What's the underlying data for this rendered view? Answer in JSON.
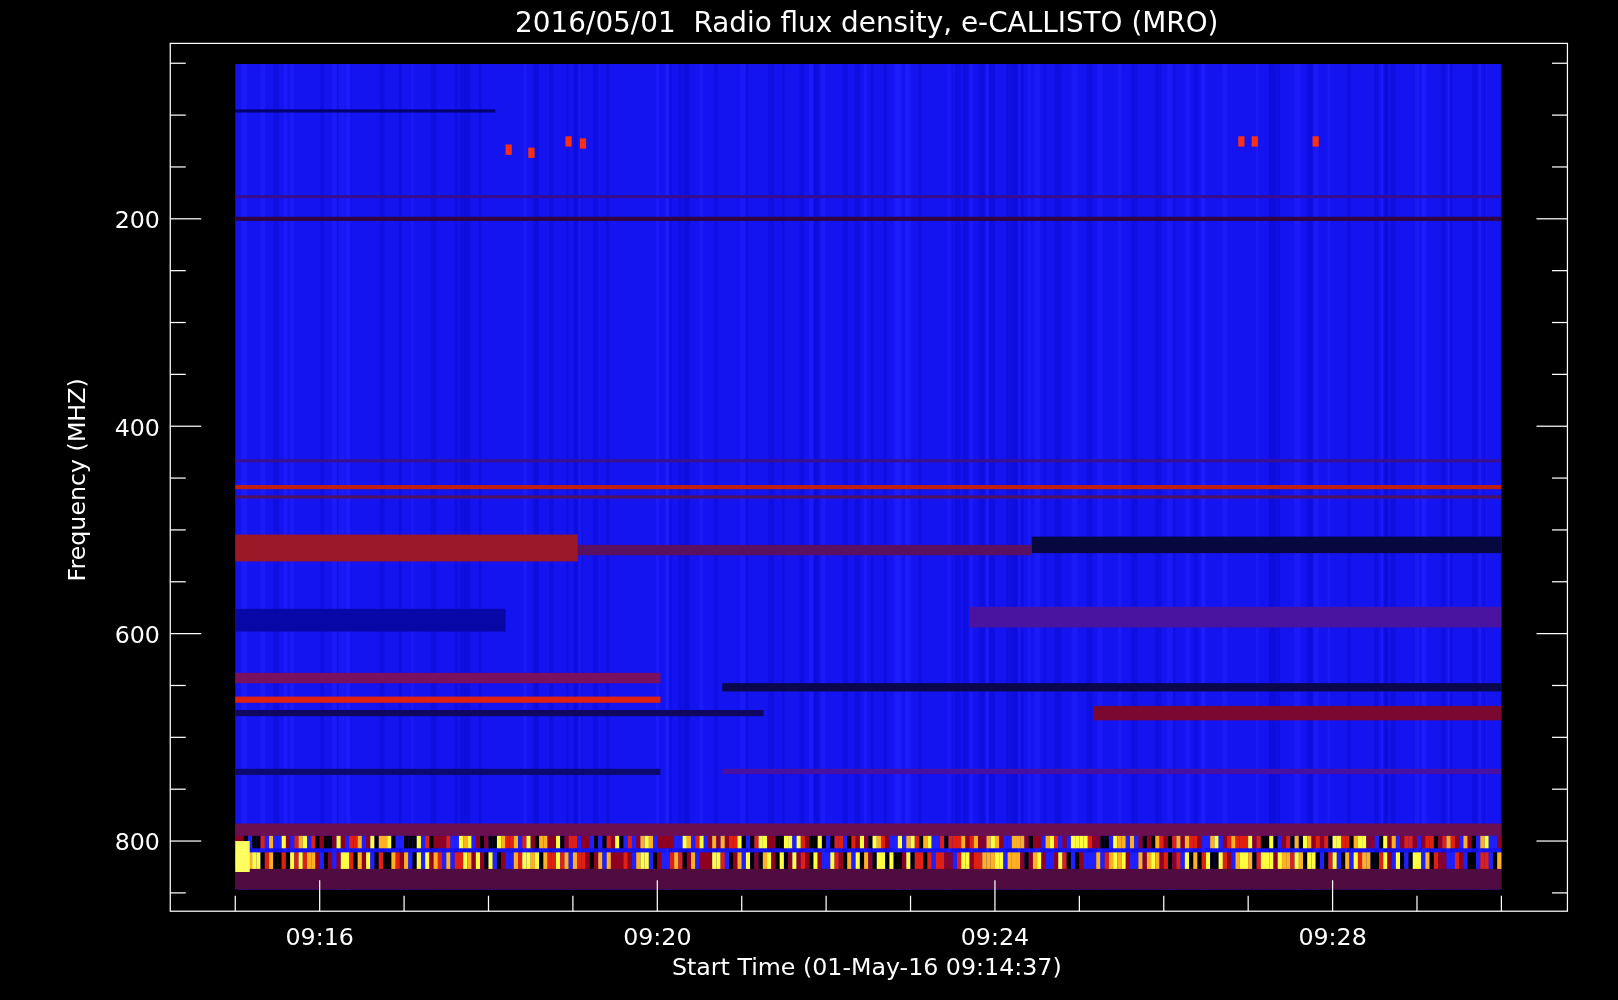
{
  "title": "2016/05/01  Radio flux density, e-CALLISTO (MRO)",
  "y_axis": {
    "label": "Frequency (MHZ)",
    "ticks": [
      "200",
      "400",
      "600",
      "800"
    ]
  },
  "x_axis": {
    "label": "Start Time (01-May-16 09:14:37)",
    "ticks": [
      "09:16",
      "09:20",
      "09:24",
      "09:28"
    ]
  }
}
